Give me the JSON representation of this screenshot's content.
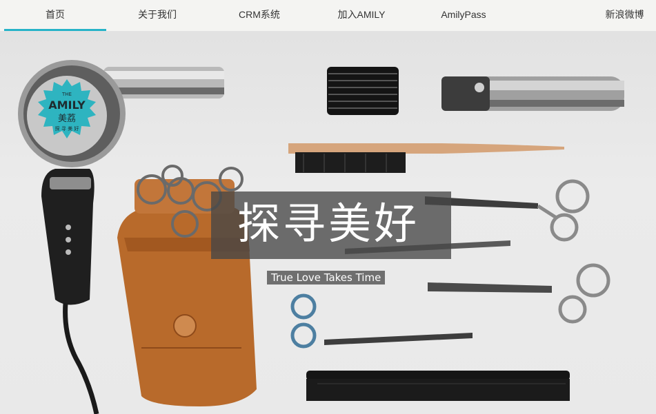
{
  "nav": {
    "items": [
      {
        "label": "首页",
        "active": true
      },
      {
        "label": "关于我们",
        "active": false
      },
      {
        "label": "CRM系统",
        "active": false
      },
      {
        "label": "加入AMILY",
        "active": false
      },
      {
        "label": "AmilyPass",
        "active": false
      },
      {
        "label": "新浪微博",
        "active": false
      }
    ],
    "accent_color": "#26b3c8"
  },
  "hero": {
    "title": "探寻美好",
    "subtitle": "True Love Takes Time",
    "badge": {
      "top": "THE",
      "brand": "AMILY",
      "cn": "美荔",
      "tagline": "探 寻 美 好"
    },
    "tools": [
      "hair-dryer-icon",
      "comb-attachment-icon",
      "clipper-icon",
      "brush-icon",
      "scissors-icon",
      "leather-holster-icon",
      "comb-icon"
    ]
  }
}
